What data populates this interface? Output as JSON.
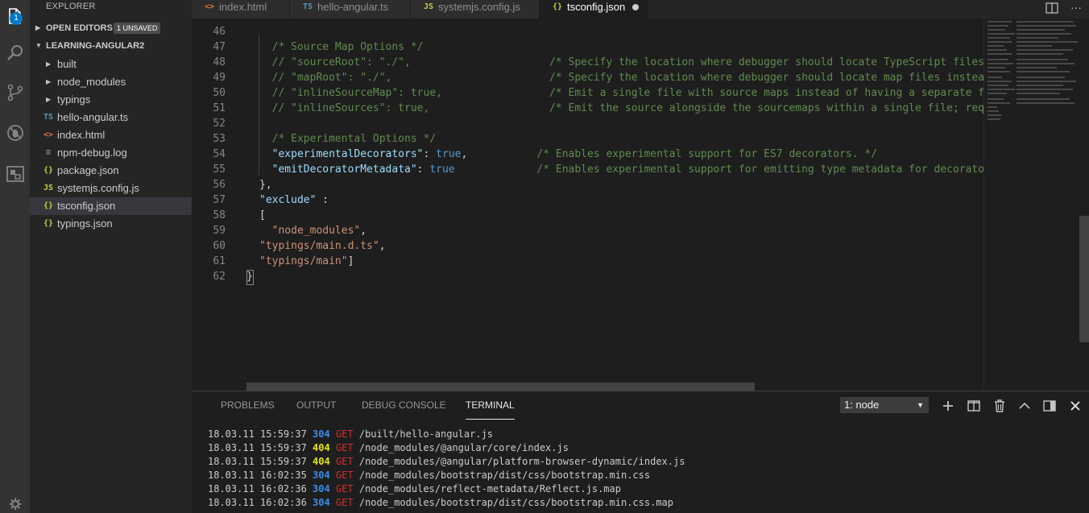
{
  "activity_bar": {
    "icons": [
      "explorer-icon",
      "search-icon",
      "source-control-icon",
      "debug-icon",
      "extensions-icon",
      "gear-icon"
    ],
    "explorer_badge": "1"
  },
  "sidebar": {
    "title": "EXPLORER",
    "open_editors_label": "OPEN EDITORS",
    "unsaved_label": "1 UNSAVED",
    "project_label": "LEARNING-ANGULAR2",
    "items": [
      {
        "name": "built",
        "kind": "folder"
      },
      {
        "name": "node_modules",
        "kind": "folder"
      },
      {
        "name": "typings",
        "kind": "folder"
      },
      {
        "name": "hello-angular.ts",
        "kind": "ts",
        "icon": "TS"
      },
      {
        "name": "index.html",
        "kind": "html",
        "icon": "<>"
      },
      {
        "name": "npm-debug.log",
        "kind": "log",
        "icon": "≡"
      },
      {
        "name": "package.json",
        "kind": "json",
        "icon": "{}"
      },
      {
        "name": "systemjs.config.js",
        "kind": "js",
        "icon": "JS"
      },
      {
        "name": "tsconfig.json",
        "kind": "json",
        "icon": "{}",
        "selected": true
      },
      {
        "name": "typings.json",
        "kind": "json",
        "icon": "{}"
      }
    ]
  },
  "tabs": [
    {
      "label": "index.html",
      "icon": "<>"
    },
    {
      "label": "hello-angular.ts",
      "icon": "TS"
    },
    {
      "label": "systemjs.config.js",
      "icon": "JS"
    },
    {
      "label": "tsconfig.json",
      "icon": "{}",
      "active": true,
      "unsaved": true
    }
  ],
  "editor": {
    "lines": [
      {
        "n": "46",
        "segments": []
      },
      {
        "n": "47",
        "segments": [
          {
            "t": "  /* Source Map Options */",
            "c": "comment"
          }
        ]
      },
      {
        "n": "48",
        "segments": [
          {
            "t": "  // \"sourceRoot\": \"./\",                      ",
            "c": "comment"
          },
          {
            "t": "/* Specify the location where debugger should locate TypeScript files ins",
            "c": "comment"
          }
        ]
      },
      {
        "n": "49",
        "segments": [
          {
            "t": "  // \"mapRoot\": \"./\",                         ",
            "c": "comment"
          },
          {
            "t": "/* Specify the location where debugger should locate map files instead of",
            "c": "comment"
          }
        ]
      },
      {
        "n": "50",
        "segments": [
          {
            "t": "  // \"inlineSourceMap\": true,                 ",
            "c": "comment"
          },
          {
            "t": "/* Emit a single file with source maps instead of having a separate file.",
            "c": "comment"
          }
        ]
      },
      {
        "n": "51",
        "segments": [
          {
            "t": "  // \"inlineSources\": true,                   ",
            "c": "comment"
          },
          {
            "t": "/* Emit the source alongside the sourcemaps within a single file; require",
            "c": "comment"
          }
        ]
      },
      {
        "n": "52",
        "segments": []
      },
      {
        "n": "53",
        "segments": [
          {
            "t": "  /* Experimental Options */",
            "c": "comment"
          }
        ]
      },
      {
        "n": "54",
        "segments": [
          {
            "t": "  ",
            "c": "punc"
          },
          {
            "t": "\"experimentalDecorators\"",
            "c": "key"
          },
          {
            "t": ": ",
            "c": "punc"
          },
          {
            "t": "true",
            "c": "bool"
          },
          {
            "t": ",           ",
            "c": "punc"
          },
          {
            "t": "/* Enables experimental support for ES7 decorators. */",
            "c": "comment"
          }
        ]
      },
      {
        "n": "55",
        "segments": [
          {
            "t": "  ",
            "c": "punc"
          },
          {
            "t": "\"emitDecoratorMetadata\"",
            "c": "key"
          },
          {
            "t": ": ",
            "c": "punc"
          },
          {
            "t": "true",
            "c": "bool"
          },
          {
            "t": "             ",
            "c": "punc"
          },
          {
            "t": "/* Enables experimental support for emitting type metadata for decorators",
            "c": "comment"
          }
        ]
      },
      {
        "n": "56",
        "segments": [
          {
            "t": "},",
            "c": "punc"
          }
        ]
      },
      {
        "n": "57",
        "segments": [
          {
            "t": "\"exclude\"",
            "c": "key"
          },
          {
            "t": " :",
            "c": "punc"
          }
        ]
      },
      {
        "n": "58",
        "segments": [
          {
            "t": "[",
            "c": "punc"
          }
        ]
      },
      {
        "n": "59",
        "segments": [
          {
            "t": "  \"node_modules\"",
            "c": "str"
          },
          {
            "t": ",",
            "c": "punc"
          }
        ]
      },
      {
        "n": "60",
        "segments": [
          {
            "t": "\"typings/main.d.ts\"",
            "c": "str"
          },
          {
            "t": ",",
            "c": "punc"
          }
        ]
      },
      {
        "n": "61",
        "segments": [
          {
            "t": "\"typings/main\"",
            "c": "str"
          },
          {
            "t": "]",
            "c": "punc"
          }
        ]
      },
      {
        "n": "62",
        "segments": [
          {
            "t": "}",
            "c": "punc"
          }
        ]
      }
    ]
  },
  "panel": {
    "tabs": [
      "PROBLEMS",
      "OUTPUT",
      "DEBUG CONSOLE",
      "TERMINAL"
    ],
    "active_tab": "TERMINAL",
    "terminal_select": "1: node",
    "action_icons": [
      "plus-icon",
      "split-icon",
      "trash-icon",
      "chevron-up-icon",
      "layout-icon",
      "close-icon"
    ],
    "terminal_lines": [
      {
        "ts": "18.03.11 15:59:37",
        "code": "304",
        "method": "GET",
        "path": "/built/hello-angular.js"
      },
      {
        "ts": "18.03.11 15:59:37",
        "code": "404",
        "method": "GET",
        "path": "/node_modules/@angular/core/index.js"
      },
      {
        "ts": "18.03.11 15:59:37",
        "code": "404",
        "method": "GET",
        "path": "/node_modules/@angular/platform-browser-dynamic/index.js"
      },
      {
        "ts": "18.03.11 16:02:35",
        "code": "304",
        "method": "GET",
        "path": "/node_modules/bootstrap/dist/css/bootstrap.min.css"
      },
      {
        "ts": "18.03.11 16:02:36",
        "code": "304",
        "method": "GET",
        "path": "/node_modules/reflect-metadata/Reflect.js.map"
      },
      {
        "ts": "18.03.11 16:02:36",
        "code": "304",
        "method": "GET",
        "path": "/node_modules/bootstrap/dist/css/bootstrap.min.css.map"
      }
    ]
  },
  "colors": {
    "accent": "#007acc",
    "status_304": "#3b8eea",
    "status_404": "#e5e510",
    "method_get": "#cd3131"
  }
}
